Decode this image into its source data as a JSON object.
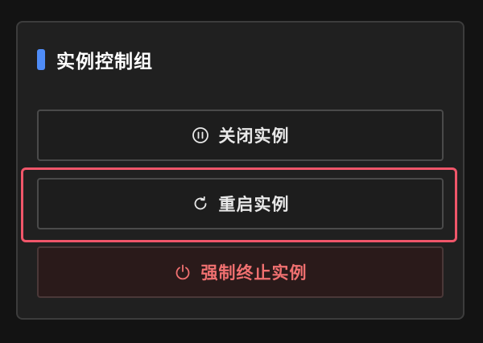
{
  "panel": {
    "title": "实例控制组",
    "accent_color": "#4f8cf7"
  },
  "buttons": {
    "close": {
      "label": "关闭实例",
      "icon": "pause-circle-icon"
    },
    "restart": {
      "label": "重启实例",
      "icon": "refresh-icon"
    },
    "kill": {
      "label": "强制终止实例",
      "icon": "power-icon",
      "color": "#f07070"
    }
  },
  "highlight": {
    "target": "restart",
    "color": "#f0566a"
  }
}
